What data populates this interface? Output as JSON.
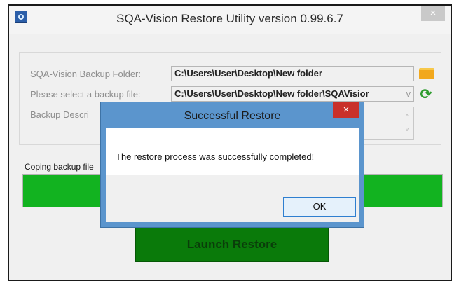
{
  "window": {
    "title": "SQA-Vision Restore Utility version 0.99.6.7",
    "close_label": "×"
  },
  "form": {
    "backup_folder_label": "SQA-Vision Backup Folder:",
    "backup_folder_value": "C:\\Users\\User\\Desktop\\New folder",
    "backup_file_label": "Please select a backup file:",
    "backup_file_value": "C:\\Users\\User\\Desktop\\New folder\\SQAVisior",
    "description_label": "Backup Descri",
    "scroll_up": "^",
    "scroll_down": "v",
    "dropdown_arrow": "v"
  },
  "progress": {
    "label": "Coping backup file",
    "percent": 100,
    "color": "#12b320"
  },
  "launch_button": {
    "label": "Launch Restore"
  },
  "dialog": {
    "title": "Successful Restore",
    "close_label": "×",
    "message": "The restore process was successfully completed!",
    "ok_label": "OK"
  },
  "icons": {
    "folder": "folder-icon",
    "refresh": "refresh-icon",
    "app": "app-icon"
  }
}
